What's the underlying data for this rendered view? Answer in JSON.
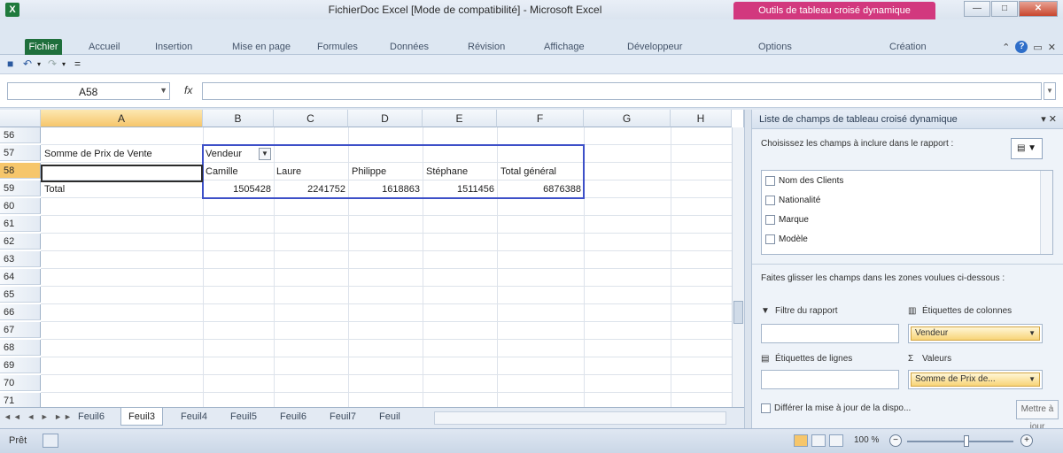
{
  "window": {
    "title": "FichierDoc Excel [Mode de compatibilité] - Microsoft Excel",
    "context_tab": "Outils de tableau croisé dynamique"
  },
  "ribbon": {
    "file_tab": "Fichier",
    "tabs": [
      "Accueil",
      "Insertion",
      "Mise en page",
      "Formules",
      "Données",
      "Révision",
      "Affichage",
      "Développeur",
      "Options",
      "Création"
    ]
  },
  "formula_bar": {
    "name_box": "A58",
    "fx": "fx",
    "formula": ""
  },
  "grid": {
    "columns": [
      "A",
      "B",
      "C",
      "D",
      "E",
      "F",
      "G",
      "H"
    ],
    "rows": [
      "56",
      "57",
      "58",
      "59",
      "60",
      "61",
      "62",
      "63",
      "64",
      "65",
      "66",
      "67",
      "68",
      "69",
      "70",
      "71"
    ],
    "pivot": {
      "value_label": "Somme de Prix de Vente",
      "column_field": "Vendeur",
      "headers": [
        "Camille",
        "Laure",
        "Philippe",
        "Stéphane",
        "Total général"
      ],
      "row_label": "Total",
      "values": [
        "1505428",
        "2241752",
        "1618863",
        "1511456",
        "6876388"
      ]
    }
  },
  "sheets": {
    "nav": "◄◄ ◄ ► ►►",
    "tabs": [
      "Feuil6",
      "Feuil3",
      "Feuil4",
      "Feuil5",
      "Feuil6",
      "Feuil7",
      "Feuil"
    ],
    "active_index": 1
  },
  "status": {
    "text": "Prêt",
    "zoom": "100 %"
  },
  "panel": {
    "title": "Liste de champs de tableau croisé dynamique",
    "choose_text": "Choisissez les champs à inclure dans le rapport :",
    "fields": [
      "Nom des Clients",
      "Nationalité",
      "Marque",
      "Modèle"
    ],
    "drag_hint": "Faites glisser les champs dans les zones voulues ci-dessous :",
    "report_filter": "Filtre du rapport",
    "column_labels": "Étiquettes de colonnes",
    "column_field": "Vendeur",
    "row_labels": "Étiquettes de lignes",
    "values_label": "Valeurs",
    "values_field": "Somme de Prix de...",
    "defer": "Différer la mise à jour de la dispo...",
    "update": "Mettre à jour"
  }
}
